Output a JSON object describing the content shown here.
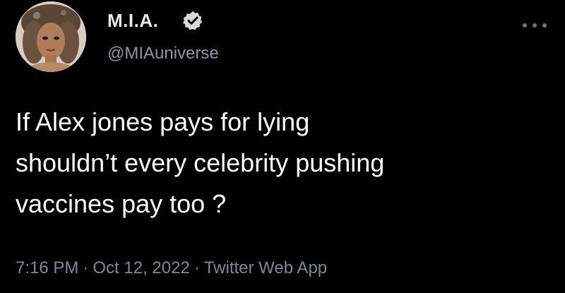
{
  "user": {
    "display_name": "M.I.A.",
    "handle": "@MIAuniverse",
    "verified": true
  },
  "icons": {
    "verified": "verified-badge-icon",
    "more": "more-options-icon"
  },
  "tweet": {
    "lines": [
      "If Alex jones pays for lying",
      "shouldn’t every celebrity pushing",
      "vaccines pay too ?"
    ],
    "time": "7:16 PM",
    "date": "Oct 12, 2022",
    "source": "Twitter Web App",
    "separator": "·"
  },
  "colors": {
    "background": "#000000",
    "text": "#ffffff",
    "secondary": "#8b98a5"
  }
}
